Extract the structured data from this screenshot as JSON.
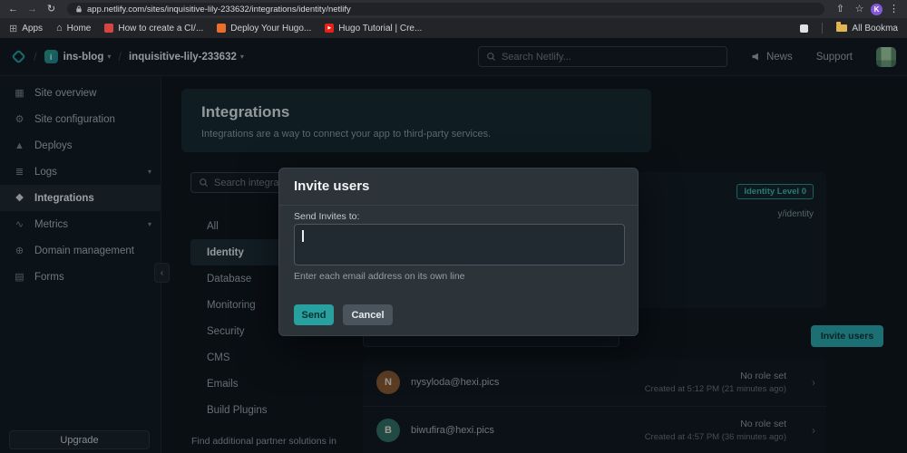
{
  "browser": {
    "url": "app.netlify.com/sites/inquisitive-lily-233632/integrations/identity/netlify",
    "profile_initial": "K",
    "bookmarks": [
      {
        "label": "Apps"
      },
      {
        "label": "Home"
      },
      {
        "label": "How to create a CI/..."
      },
      {
        "label": "Deploy Your Hugo..."
      },
      {
        "label": "Hugo Tutorial | Cre..."
      }
    ],
    "all_bookmarks_label": "All Bookma"
  },
  "app_header": {
    "team_initial": "i",
    "team": "ins-blog",
    "site": "inquisitive-lily-233632",
    "search_placeholder": "Search Netlify...",
    "news_label": "News",
    "support_label": "Support"
  },
  "sidebar": {
    "items": [
      {
        "label": "Site overview",
        "icon": "▦"
      },
      {
        "label": "Site configuration",
        "icon": "⚙"
      },
      {
        "label": "Deploys",
        "icon": "▲"
      },
      {
        "label": "Logs",
        "icon": "≣"
      },
      {
        "label": "Integrations",
        "icon": "❖"
      },
      {
        "label": "Metrics",
        "icon": "∿"
      },
      {
        "label": "Domain management",
        "icon": "⊕"
      },
      {
        "label": "Forms",
        "icon": "▤"
      }
    ],
    "upgrade_label": "Upgrade"
  },
  "main": {
    "title": "Integrations",
    "subtitle": "Integrations are a way to connect your app to third-party services.",
    "search_placeholder": "Search integrations",
    "categories": [
      "All",
      "Identity",
      "Database",
      "Monitoring",
      "Security",
      "CMS",
      "Emails",
      "Build Plugins"
    ],
    "selected_category": "Identity",
    "partner_note": "Find additional partner solutions in",
    "identity": {
      "level_badge": "Identity Level 0",
      "endpoint_fragment": "y/identity",
      "invite_button_label": "Invite users"
    },
    "users": [
      {
        "initial": "N",
        "avatar_color": "#8a5a33",
        "email": "nysyloda@hexi.pics",
        "role": "No role set",
        "created": "Created at 5:12 PM (21 minutes ago)"
      },
      {
        "initial": "B",
        "avatar_color": "#2f6e62",
        "email": "biwufira@hexi.pics",
        "role": "No role set",
        "created": "Created at 4:57 PM (36 minutes ago)"
      }
    ]
  },
  "modal": {
    "title": "Invite users",
    "invites_label": "Send Invites to:",
    "helper": "Enter each email address on its own line",
    "send_label": "Send",
    "cancel_label": "Cancel"
  },
  "colors": {
    "accent_teal": "#2aa6aa",
    "badge_teal": "#3cb6ad"
  }
}
